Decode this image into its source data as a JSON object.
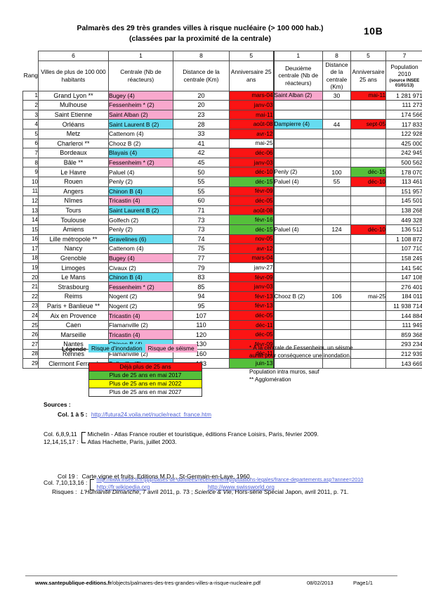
{
  "doc": {
    "title_line1": "Palmarès des 29 très grandes villes à risque nucléaire (> 100 000 hab.)",
    "title_line2": "(classées par la proximité de la centrale)",
    "code": "10B"
  },
  "table": {
    "col_numbers": [
      "6",
      "1",
      "8",
      "5",
      "1",
      "8",
      "5",
      "7"
    ],
    "rang_label": "Rang",
    "headers": {
      "ville": "Villes de plus de 100 000 habitants",
      "centrale": "Centrale (Nb de réacteurs)",
      "distance": "Distance de la centrale (Km)",
      "anniversaire": "Anniversaire 25 ans",
      "centrale2": "Deuxième centrale (Nb de réacteurs)",
      "distance2": "Distance de la centrale (Km)",
      "anniversaire2": "Anniversaire 25 ans",
      "population": "Population 2010",
      "population_sub": "(source INSEE 01/01/13)"
    },
    "rows": [
      {
        "rang": "1",
        "ville": "Grand Lyon **",
        "centrale": "Bugey (4)",
        "centrale_bg": "quake",
        "distance": "20",
        "anniv": "mars-04",
        "anniv_bg": "red",
        "centrale2": "Saint Alban (2)",
        "centrale2_bg": "quake",
        "distance2": "30",
        "anniv2": "mai-11",
        "anniv2_bg": "red",
        "pop": "1 281 971"
      },
      {
        "rang": "2",
        "ville": "Mulhouse",
        "centrale": "Fessenheim * (2)",
        "centrale_bg": "quake",
        "distance": "20",
        "anniv": "janv-03",
        "anniv_bg": "red",
        "centrale2": "",
        "centrale2_bg": "white",
        "distance2": "",
        "anniv2": "",
        "anniv2_bg": "white",
        "pop": "111 273"
      },
      {
        "rang": "3",
        "ville": "Saint Etienne",
        "centrale": "Saint Alban (2)",
        "centrale_bg": "quake",
        "distance": "23",
        "anniv": "mai-11",
        "anniv_bg": "red",
        "centrale2": "",
        "centrale2_bg": "white",
        "distance2": "",
        "anniv2": "",
        "anniv2_bg": "white",
        "pop": "174 566"
      },
      {
        "rang": "4",
        "ville": "Orléans",
        "centrale": "Saint Laurent B (2)",
        "centrale_bg": "flood",
        "distance": "28",
        "anniv": "août-08",
        "anniv_bg": "red",
        "centrale2": "Dampierre (4)",
        "centrale2_bg": "flood",
        "distance2": "44",
        "anniv2": "sept-05",
        "anniv2_bg": "red",
        "pop": "117 833"
      },
      {
        "rang": "5",
        "ville": "Metz",
        "centrale": "Cattenom (4)",
        "centrale_bg": "white",
        "distance": "33",
        "anniv": "avr-12",
        "anniv_bg": "red",
        "centrale2": "",
        "centrale2_bg": "white",
        "distance2": "",
        "anniv2": "",
        "anniv2_bg": "white",
        "pop": "122 928"
      },
      {
        "rang": "6",
        "ville": "Charleroi **",
        "centrale": "Chooz B (2)",
        "centrale_bg": "white",
        "distance": "41",
        "anniv": "mai-25",
        "anniv_bg": "white",
        "centrale2": "",
        "centrale2_bg": "white",
        "distance2": "",
        "anniv2": "",
        "anniv2_bg": "white",
        "pop": "425 000"
      },
      {
        "rang": "7",
        "ville": "Bordeaux",
        "centrale": "Blayais (4)",
        "centrale_bg": "flood",
        "distance": "42",
        "anniv": "déc-06",
        "anniv_bg": "red",
        "centrale2": "",
        "centrale2_bg": "white",
        "distance2": "",
        "anniv2": "",
        "anniv2_bg": "white",
        "pop": "242 945"
      },
      {
        "rang": "8",
        "ville": "Bâle **",
        "centrale": "Fessenheim * (2)",
        "centrale_bg": "quake",
        "distance": "45",
        "anniv": "janv-03",
        "anniv_bg": "red",
        "centrale2": "",
        "centrale2_bg": "white",
        "distance2": "",
        "anniv2": "",
        "anniv2_bg": "white",
        "pop": "500 562"
      },
      {
        "rang": "9",
        "ville": "Le Havre",
        "centrale": "Paluel (4)",
        "centrale_bg": "white",
        "distance": "50",
        "anniv": "déc-10",
        "anniv_bg": "red",
        "centrale2": "Penly (2)",
        "centrale2_bg": "white",
        "distance2": "100",
        "anniv2": "déc-15",
        "anniv2_bg": "green",
        "pop": "178 070"
      },
      {
        "rang": "10",
        "ville": "Rouen",
        "centrale": "Penly (2)",
        "centrale_bg": "white",
        "distance": "55",
        "anniv": "déc-15",
        "anniv_bg": "green",
        "centrale2": "Paluel (4)",
        "centrale2_bg": "white",
        "distance2": "55",
        "anniv2": "déc-10",
        "anniv2_bg": "red",
        "pop": "113 461"
      },
      {
        "rang": "11",
        "ville": "Angers",
        "centrale": "Chinon B (4)",
        "centrale_bg": "flood",
        "distance": "55",
        "anniv": "févr-09",
        "anniv_bg": "red",
        "centrale2": "",
        "centrale2_bg": "white",
        "distance2": "",
        "anniv2": "",
        "anniv2_bg": "white",
        "pop": "151 957"
      },
      {
        "rang": "12",
        "ville": "Nîmes",
        "centrale": "Tricastin (4)",
        "centrale_bg": "quake",
        "distance": "60",
        "anniv": "déc-05",
        "anniv_bg": "red",
        "centrale2": "",
        "centrale2_bg": "white",
        "distance2": "",
        "anniv2": "",
        "anniv2_bg": "white",
        "pop": "145 501"
      },
      {
        "rang": "13",
        "ville": "Tours",
        "centrale": "Saint Laurent B (2)",
        "centrale_bg": "flood",
        "distance": "71",
        "anniv": "août-08",
        "anniv_bg": "red",
        "centrale2": "",
        "centrale2_bg": "white",
        "distance2": "",
        "anniv2": "",
        "anniv2_bg": "white",
        "pop": "138 268"
      },
      {
        "rang": "14",
        "ville": "Toulouse",
        "centrale": "Golfech (2)",
        "centrale_bg": "white",
        "distance": "73",
        "anniv": "févr-16",
        "anniv_bg": "green",
        "centrale2": "",
        "centrale2_bg": "white",
        "distance2": "",
        "anniv2": "",
        "anniv2_bg": "white",
        "pop": "449 328"
      },
      {
        "rang": "15",
        "ville": "Amiens",
        "centrale": "Penly (2)",
        "centrale_bg": "white",
        "distance": "73",
        "anniv": "déc-15",
        "anniv_bg": "green",
        "centrale2": "Paluel (4)",
        "centrale2_bg": "white",
        "distance2": "124",
        "anniv2": "déc-10",
        "anniv2_bg": "red",
        "pop": "136 512"
      },
      {
        "rang": "16",
        "ville": "Lille métropole **",
        "centrale": "Gravelines (6)",
        "centrale_bg": "flood",
        "distance": "74",
        "anniv": "nov-05",
        "anniv_bg": "red",
        "centrale2": "",
        "centrale2_bg": "white",
        "distance2": "",
        "anniv2": "",
        "anniv2_bg": "white",
        "pop": "1 108 872"
      },
      {
        "rang": "17",
        "ville": "Nancy",
        "centrale": "Cattenom (4)",
        "centrale_bg": "white",
        "distance": "75",
        "anniv": "avr-12",
        "anniv_bg": "red",
        "centrale2": "",
        "centrale2_bg": "white",
        "distance2": "",
        "anniv2": "",
        "anniv2_bg": "white",
        "pop": "107 710"
      },
      {
        "rang": "18",
        "ville": "Grenoble",
        "centrale": "Bugey (4)",
        "centrale_bg": "quake",
        "distance": "77",
        "anniv": "mars-04",
        "anniv_bg": "red",
        "centrale2": "",
        "centrale2_bg": "white",
        "distance2": "",
        "anniv2": "",
        "anniv2_bg": "white",
        "pop": "158 249"
      },
      {
        "rang": "19",
        "ville": "Limoges",
        "centrale": "Civaux (2)",
        "centrale_bg": "white",
        "distance": "79",
        "anniv": "janv-27",
        "anniv_bg": "white",
        "centrale2": "",
        "centrale2_bg": "white",
        "distance2": "",
        "anniv2": "",
        "anniv2_bg": "white",
        "pop": "141 540"
      },
      {
        "rang": "20",
        "ville": "Le Mans",
        "centrale": "Chinon B (4)",
        "centrale_bg": "flood",
        "distance": "83",
        "anniv": "févr-09",
        "anniv_bg": "red",
        "centrale2": "",
        "centrale2_bg": "white",
        "distance2": "",
        "anniv2": "",
        "anniv2_bg": "white",
        "pop": "147 108"
      },
      {
        "rang": "21",
        "ville": "Strasbourg",
        "centrale": "Fessenheim * (2)",
        "centrale_bg": "quake",
        "distance": "85",
        "anniv": "janv-03",
        "anniv_bg": "red",
        "centrale2": "",
        "centrale2_bg": "white",
        "distance2": "",
        "anniv2": "",
        "anniv2_bg": "white",
        "pop": "276 401"
      },
      {
        "rang": "22",
        "ville": "Reims",
        "centrale": "Nogent (2)",
        "centrale_bg": "white",
        "distance": "94",
        "anniv": "févr-13",
        "anniv_bg": "red",
        "centrale2": "Chooz B (2)",
        "centrale2_bg": "white",
        "distance2": "106",
        "anniv2": "mai-25",
        "anniv2_bg": "white",
        "pop": "184 011"
      },
      {
        "rang": "23",
        "ville": "Paris + Banlieue **",
        "centrale": "Nogent (2)",
        "centrale_bg": "white",
        "distance": "95",
        "anniv": "févr-13",
        "anniv_bg": "red",
        "centrale2": "",
        "centrale2_bg": "white",
        "distance2": "",
        "anniv2": "",
        "anniv2_bg": "white",
        "pop": "11 938 714"
      },
      {
        "rang": "24",
        "ville": "Aix en Provence",
        "centrale": "Tricastin (4)",
        "centrale_bg": "quake",
        "distance": "107",
        "anniv": "déc-05",
        "anniv_bg": "red",
        "centrale2": "",
        "centrale2_bg": "white",
        "distance2": "",
        "anniv2": "",
        "anniv2_bg": "white",
        "pop": "144 884"
      },
      {
        "rang": "25",
        "ville": "Caen",
        "centrale": "Flamanville (2)",
        "centrale_bg": "white",
        "distance": "110",
        "anniv": "déc-11",
        "anniv_bg": "red",
        "centrale2": "",
        "centrale2_bg": "white",
        "distance2": "",
        "anniv2": "",
        "anniv2_bg": "white",
        "pop": "111 949"
      },
      {
        "rang": "26",
        "ville": "Marseille",
        "centrale": "Tricastin (4)",
        "centrale_bg": "quake",
        "distance": "120",
        "anniv": "déc-05",
        "anniv_bg": "red",
        "centrale2": "",
        "centrale2_bg": "white",
        "distance2": "",
        "anniv2": "",
        "anniv2_bg": "white",
        "pop": "859 368"
      },
      {
        "rang": "27",
        "ville": "Nantes",
        "centrale": "Chinon B (4)",
        "centrale_bg": "flood",
        "distance": "130",
        "anniv": "févr-09",
        "anniv_bg": "red",
        "centrale2": "",
        "centrale2_bg": "white",
        "distance2": "",
        "anniv2": "",
        "anniv2_bg": "white",
        "pop": "293 234"
      },
      {
        "rang": "28",
        "ville": "Rennes",
        "centrale": "Flamanville (2)",
        "centrale_bg": "white",
        "distance": "160",
        "anniv": "déc-11",
        "anniv_bg": "red",
        "centrale2": "",
        "centrale2_bg": "white",
        "distance2": "",
        "anniv2": "",
        "anniv2_bg": "white",
        "pop": "212 939"
      },
      {
        "rang": "29",
        "ville": "Clermont Ferrand",
        "centrale": "Belleville (2)",
        "centrale_bg": "flood",
        "distance": "183",
        "anniv": "juin-13",
        "anniv_bg": "green",
        "centrale2": "",
        "centrale2_bg": "white",
        "distance2": "",
        "anniv2": "",
        "anniv2_bg": "white",
        "pop": "143 669"
      }
    ]
  },
  "legend": {
    "label": "Légende :",
    "risk_flood": "Risque d'inondation",
    "risk_quake": "Risque de séisme",
    "age": [
      {
        "text": "Déjà plus de 25 ans",
        "bg": "red"
      },
      {
        "text": "Plus de 25 ans en mai 2017",
        "bg": "green"
      },
      {
        "text": "Plus de 25 ans en mai 2022",
        "bg": "yellow"
      },
      {
        "text": "Plus de 25 ans en mai 2027",
        "bg": "white"
      }
    ],
    "note_star_l1": "* À la centrale de Fessenheim, un séisme",
    "note_star_l2": "aurait pour conséquence une inondation.",
    "note_pop_l1": "Population intra muros, sauf",
    "note_pop_l2": "** Agglomération"
  },
  "colors": {
    "flood": "#66dcf0",
    "quake": "#f9a8cd",
    "red": "#fb1414",
    "green": "#55c03b",
    "yellow": "#fbff00",
    "white": "#ffffff",
    "link": "#4d5fd6"
  },
  "sources": {
    "title": "Sources :",
    "col1_label": "Col. 1 à 5 :",
    "col1_link": "http://futura24.voila.net/nucle/react_france.htm",
    "col2_label_l1": "Col. 6,8,9,11",
    "col2_label_l2": "12,14,15,17 :",
    "col2_line1": "Michelin - Atlas France routier et touristique, éditions France Loisirs, Paris, février 2009.",
    "col2_line2": "Atlas Hachette, Paris, juillet 2003.",
    "col3_label": "Col. 7,10,13,16 :",
    "col3_link1": "http://www.insee.fr/fr/ppp/bases-de-donnees/recensement/populations-legales/france-departements.asp?annee=2010",
    "col3_link2": "http://fr.wikipedia.org",
    "col3_link3": "http://www.swissworld.org",
    "col4_label": "Col 19 :",
    "col4_text": "Carte vigne et fruits, Editions M.D.I., St-Germain-en-Laye, 1960.",
    "risks_label": "Risques :",
    "risks_a": "L'Humanité Dimanche",
    "risks_b": ", 7 avril 2011, p. 73 ; ",
    "risks_c": "Science & Vie",
    "risks_d": ", Hors-série Spécial Japon, avril 2011, p. 71."
  },
  "footer": {
    "url_bold": "www.santepublique-editions.fr",
    "url_rest": "/objects/palmares-des-tres-grandes-villes-a-risque-nucleaire.pdf",
    "date": "08/02/2013",
    "page": "Page1/1"
  }
}
